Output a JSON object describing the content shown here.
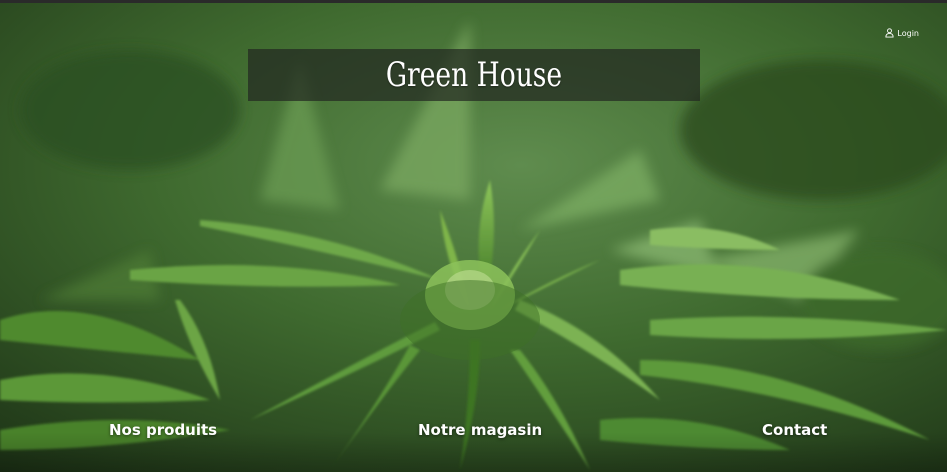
{
  "header": {
    "login_label": "Login"
  },
  "hero": {
    "title": "Green House"
  },
  "nav": {
    "items": [
      {
        "label": "Nos produits"
      },
      {
        "label": "Notre magasin"
      },
      {
        "label": "Contact"
      }
    ]
  },
  "colors": {
    "title_box": "#232821",
    "text": "#ffffff",
    "leaf_dark": "#2f5f1e",
    "leaf_light": "#7fb54a"
  },
  "icons": {
    "login": "user-icon"
  }
}
